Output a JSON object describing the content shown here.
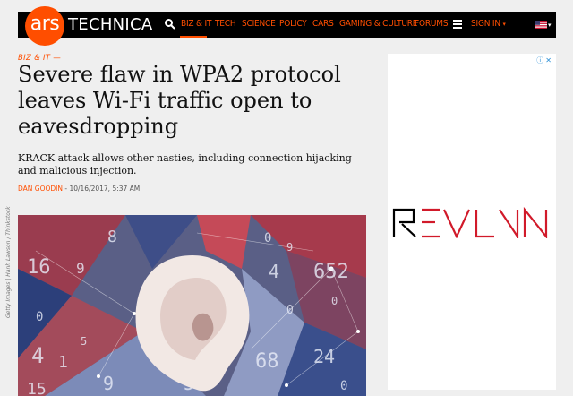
{
  "header": {
    "logo_mark": "ars",
    "logo_word": "TECHNICA",
    "nav": [
      {
        "label": "BIZ & IT",
        "active": true
      },
      {
        "label": "TECH"
      },
      {
        "label": "SCIENCE"
      },
      {
        "label": "POLICY"
      },
      {
        "label": "CARS"
      },
      {
        "label": "GAMING & CULTURE"
      },
      {
        "label": "FORUMS"
      }
    ],
    "sign_in": "SIGN IN",
    "accent": "#ff4e00"
  },
  "article": {
    "section": "BIZ & IT —",
    "title": "Severe flaw in WPA2 protocol leaves Wi-Fi traffic open to eavesdropping",
    "dek": "KRACK attack allows other nasties, including connection hijacking and malicious injection.",
    "author": "DAN GOODIN",
    "date": " - 10/16/2017, 5:37 AM",
    "image_credit": "Getty Images | Hanh Lawson / Thinkstock"
  },
  "ad": {
    "choices": "ⓘ✕",
    "logo_text": "REVLN"
  }
}
